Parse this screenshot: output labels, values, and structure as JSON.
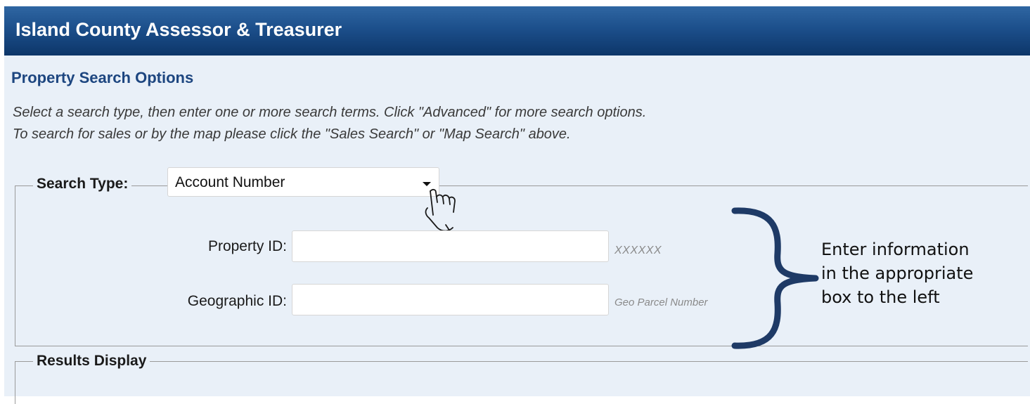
{
  "header": {
    "title": "Island County Assessor & Treasurer"
  },
  "section": {
    "title": "Property Search Options",
    "instructions": [
      "Select a search type, then enter one or more search terms. Click \"Advanced\" for more search options.",
      "To search for sales or by the map please click the \"Sales Search\" or \"Map Search\" above."
    ]
  },
  "search": {
    "type_label": "Search Type:",
    "type_value": "Account Number",
    "fields": {
      "property_id": {
        "label": "Property ID:",
        "value": "",
        "hint": "XXXXXX"
      },
      "geographic_id": {
        "label": "Geographic ID:",
        "value": "",
        "hint": "Geo Parcel Number"
      }
    }
  },
  "results": {
    "label": "Results Display"
  },
  "annotation": {
    "lines": [
      "Enter information",
      "in the appropriate",
      "box to the left"
    ]
  },
  "icons": {
    "dropdown": "chevron-down-icon",
    "cursor": "hand-pointer-icon",
    "brace": "curly-brace-icon"
  },
  "colors": {
    "header_top": "#2f66a2",
    "header_bottom": "#0d3669",
    "page_background": "#e9f0f8",
    "section_title": "#1d4680",
    "brace": "#1e3a66"
  }
}
